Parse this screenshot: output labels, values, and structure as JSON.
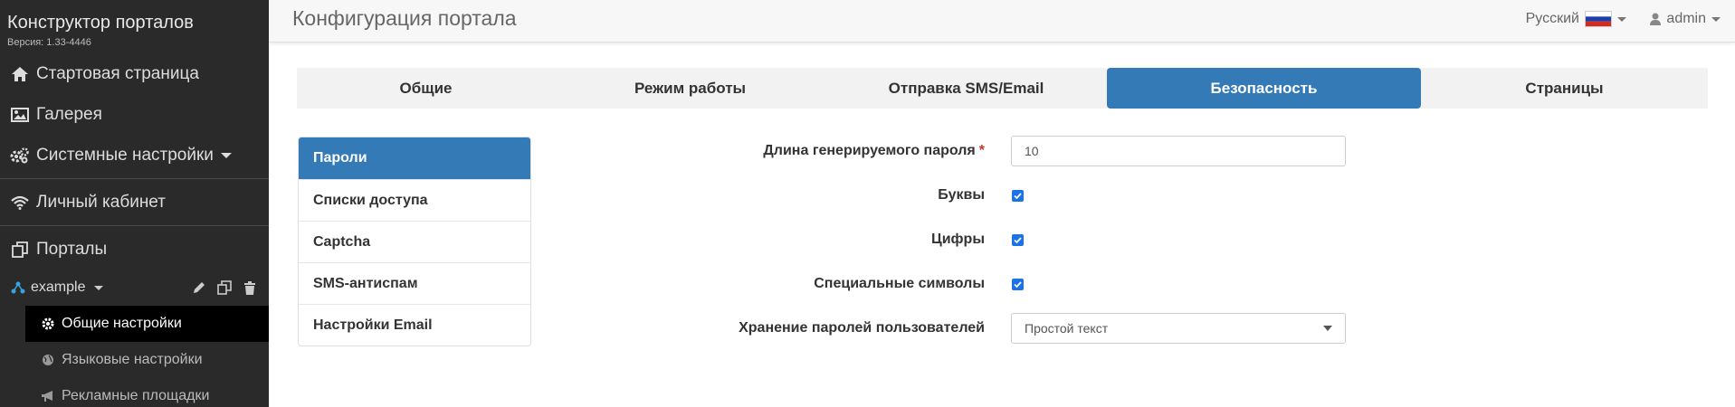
{
  "sidebar": {
    "brand_title": "Конструктор порталов",
    "version": "Версия: 1.33-4446",
    "nav": [
      {
        "label": "Стартовая страница",
        "icon": "home-icon"
      },
      {
        "label": "Галерея",
        "icon": "image-icon"
      },
      {
        "label": "Системные настройки",
        "icon": "gears-icon"
      },
      {
        "label": "Личный кабинет",
        "icon": "wifi-icon"
      },
      {
        "label": "Порталы",
        "icon": "copy-icon"
      }
    ],
    "portal": {
      "name": "example",
      "icon": "sitemap-icon"
    },
    "sub_items": [
      {
        "label": "Общие настройки",
        "icon": "gear-icon"
      },
      {
        "label": "Языковые настройки",
        "icon": "globe-icon"
      },
      {
        "label": "Рекламные площадки",
        "icon": "bullhorn-icon"
      }
    ]
  },
  "header": {
    "title": "Конфигурация портала",
    "language": "Русский",
    "user": "admin"
  },
  "tabs": [
    "Общие",
    "Режим работы",
    "Отправка SMS/Email",
    "Безопасность",
    "Страницы"
  ],
  "menu": [
    "Пароли",
    "Списки доступа",
    "Captcha",
    "SMS-антиспам",
    "Настройки Email"
  ],
  "form": {
    "password_length_label": "Длина генерируемого пароля",
    "required_mark": "*",
    "password_length_value": "10",
    "letters_label": "Буквы",
    "digits_label": "Цифры",
    "special_label": "Специальные символы",
    "storage_label": "Хранение паролей пользователей",
    "storage_value": "Простой текст"
  },
  "colors": {
    "accent": "#337ab7",
    "sidebar_bg": "#2a2a2a",
    "checkbox": "#1a73e8"
  }
}
